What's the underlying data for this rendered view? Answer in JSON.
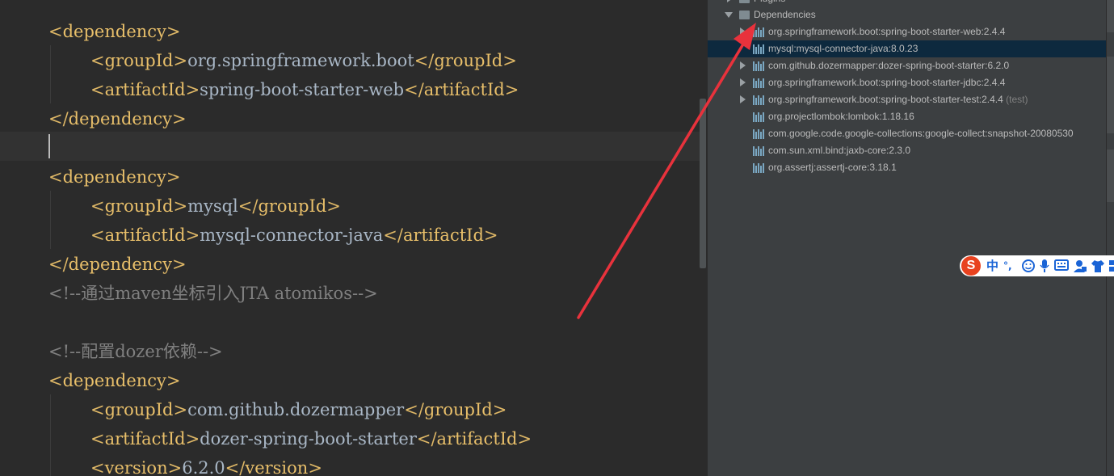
{
  "editor": {
    "lines": [
      {
        "indent": 0,
        "kind": "open",
        "tag": "dependency"
      },
      {
        "indent": 1,
        "kind": "elem",
        "tag": "groupId",
        "value": "org.springframework.boot"
      },
      {
        "indent": 1,
        "kind": "elem",
        "tag": "artifactId",
        "value": "spring-boot-starter-web"
      },
      {
        "indent": 0,
        "kind": "close",
        "tag": "dependency"
      },
      {
        "indent": 0,
        "kind": "blank"
      },
      {
        "indent": 0,
        "kind": "open",
        "tag": "dependency"
      },
      {
        "indent": 1,
        "kind": "elem",
        "tag": "groupId",
        "value": "mysql"
      },
      {
        "indent": 1,
        "kind": "elem",
        "tag": "artifactId",
        "value": "mysql-connector-java"
      },
      {
        "indent": 0,
        "kind": "close",
        "tag": "dependency"
      },
      {
        "indent": 0,
        "kind": "comment",
        "text": "<!--通过maven坐标引入JTA atomikos-->"
      },
      {
        "indent": 0,
        "kind": "blank"
      },
      {
        "indent": 0,
        "kind": "comment",
        "text": "<!--配置dozer依赖-->"
      },
      {
        "indent": 0,
        "kind": "open",
        "tag": "dependency"
      },
      {
        "indent": 1,
        "kind": "elem",
        "tag": "groupId",
        "value": "com.github.dozermapper"
      },
      {
        "indent": 1,
        "kind": "elem",
        "tag": "artifactId",
        "value": "dozer-spring-boot-starter"
      },
      {
        "indent": 1,
        "kind": "elem",
        "tag": "version",
        "value": "6.2.0"
      }
    ]
  },
  "maven_panel": {
    "plugins_label": "Plugins",
    "dependencies_label": "Dependencies",
    "dependencies": [
      {
        "name": "org.springframework.boot:spring-boot-starter-web:2.4.4",
        "expandable": true,
        "selected": false,
        "scope": ""
      },
      {
        "name": "mysql:mysql-connector-java:8.0.23",
        "expandable": false,
        "selected": true,
        "scope": ""
      },
      {
        "name": "com.github.dozermapper:dozer-spring-boot-starter:6.2.0",
        "expandable": true,
        "selected": false,
        "scope": ""
      },
      {
        "name": "org.springframework.boot:spring-boot-starter-jdbc:2.4.4",
        "expandable": true,
        "selected": false,
        "scope": ""
      },
      {
        "name": "org.springframework.boot:spring-boot-starter-test:2.4.4",
        "expandable": true,
        "selected": false,
        "scope": "(test)"
      },
      {
        "name": "org.projectlombok:lombok:1.18.16",
        "expandable": false,
        "selected": false,
        "scope": ""
      },
      {
        "name": "com.google.code.google-collections:google-collect:snapshot-20080530",
        "expandable": false,
        "selected": false,
        "scope": ""
      },
      {
        "name": "com.sun.xml.bind:jaxb-core:2.3.0",
        "expandable": false,
        "selected": false,
        "scope": ""
      },
      {
        "name": "org.assertj:assertj-core:3.18.1",
        "expandable": false,
        "selected": false,
        "scope": ""
      }
    ]
  },
  "ime_toolbar": {
    "logo": "S",
    "mode": "中",
    "punct": "°,",
    "icons": [
      "emoji-icon",
      "microphone-icon",
      "keyboard-icon",
      "user-icon",
      "shirt-icon",
      "grid-icon"
    ]
  },
  "colors": {
    "editor_bg": "#2b2b2b",
    "panel_bg": "#3c3f41",
    "tag": "#e8bf6a",
    "text": "#a9b7c6",
    "comment": "#808080",
    "selection": "#0d293e",
    "annotation_arrow": "#e8323c"
  }
}
